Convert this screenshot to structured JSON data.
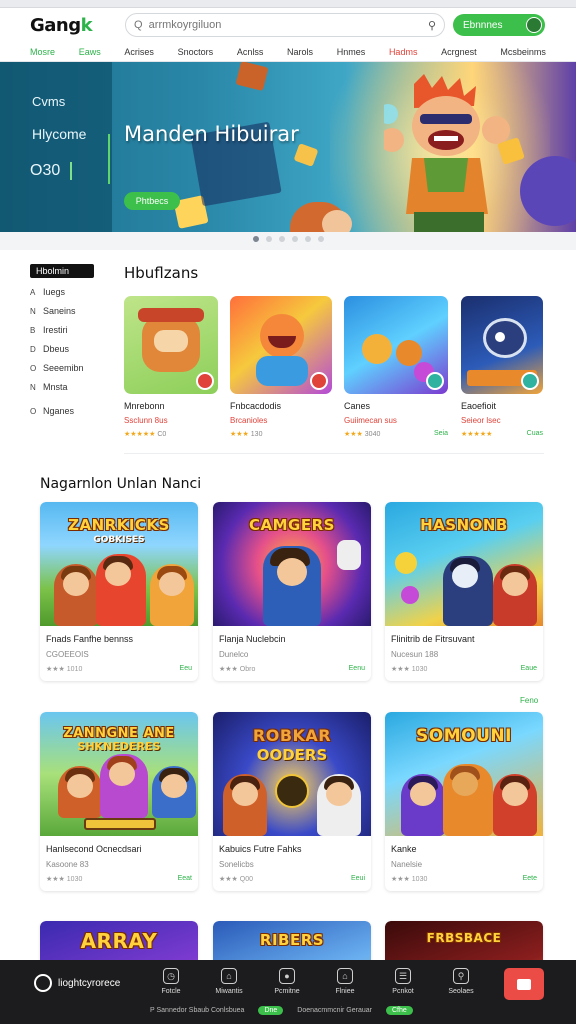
{
  "header": {
    "logo": "Gang",
    "logo_accent": "k",
    "search_placeholder": "Q  arrmkoyrgiluon",
    "cta_label": "Ebnnnes"
  },
  "nav": [
    "Mosre",
    "Eaws",
    "Acrises",
    "Snoctors",
    "Acnlss",
    "Narols",
    "Hnmes",
    "Hadms",
    "Acrgnest",
    "Mcsbeinms"
  ],
  "hero": {
    "side_line1": "Cvms",
    "side_line2": "Hlycome",
    "side_line3": "O30",
    "title": "Manden Hibuirar",
    "button": "Phtbecs"
  },
  "sidebar": {
    "header": "Hbolmin",
    "items": [
      {
        "icon": "user-icon",
        "glyph": "A",
        "label": "Iuegs"
      },
      {
        "icon": "bookmark-icon",
        "glyph": "N",
        "label": "Saneins"
      },
      {
        "icon": "calendar-icon",
        "glyph": "B",
        "label": "Irestiri"
      },
      {
        "icon": "square-icon",
        "glyph": "D",
        "label": "Dbeus"
      },
      {
        "icon": "circle-icon",
        "glyph": "O",
        "label": "Seeemibn"
      },
      {
        "icon": "grid-icon",
        "glyph": "N",
        "label": "Mnsta"
      },
      {
        "icon": "settings-icon",
        "glyph": "O",
        "label": "Nganes"
      }
    ]
  },
  "featured": {
    "title": "Hbuflzans",
    "items": [
      {
        "name": "Mnrebonn",
        "sub": "Ssclunn 8us",
        "rating": "★★★★★",
        "count": "C0",
        "action": ""
      },
      {
        "name": "Fnbcacdodis",
        "sub": "Brcanioles",
        "rating": "★★★",
        "count": "130",
        "action": ""
      },
      {
        "name": "Canes",
        "sub": "Guiimecan sus",
        "rating": "★★★",
        "count": "3040",
        "action": "Seia"
      },
      {
        "name": "Eaoefioit",
        "sub": "Seieor lsec",
        "rating": "★★★★★",
        "count": "",
        "action": "Cuas"
      }
    ]
  },
  "section": {
    "title": "Nagarnlon Unlan Nanci",
    "more": "Feno"
  },
  "cards": [
    {
      "art": "ZANRKICKS",
      "art_sub": "GOBKISES",
      "name": "Fnads Fanfhe bennss",
      "sub": "CGOEEOIS",
      "count": "1010",
      "action": "Eeu"
    },
    {
      "art": "CAMGERS",
      "art_sub": "",
      "name": "Flanja Nuclebcin",
      "sub": "Dunelco",
      "count": "Obro",
      "action": "Eenu"
    },
    {
      "art": "HASNONB",
      "art_sub": "",
      "name": "Flinitrib de Fitrsuvant",
      "sub": "Nucesun 188",
      "count": "1030",
      "action": "Eaue"
    },
    {
      "art": "ZANNGNE ANE",
      "art_sub": "SHKNEDERES",
      "name": "Hanlsecond Ocnecdsari",
      "sub": "Kasoone 83",
      "count": "1030",
      "action": "Eeat"
    },
    {
      "art": "ROBKAR",
      "art_sub": "OODERS",
      "name": "Kabuics Futre Fahks",
      "sub": "Sonelicbs",
      "count": "Q00",
      "action": "Eeui"
    },
    {
      "art": "SOMOUNI",
      "art_sub": "",
      "name": "Kanke",
      "sub": "Nanelsie",
      "count": "1030",
      "action": "Eete"
    },
    {
      "art": "ARRAY",
      "art_sub": "",
      "name": "",
      "sub": "",
      "count": "",
      "action": ""
    },
    {
      "art": "RIBERS",
      "art_sub": "",
      "name": "",
      "sub": "",
      "count": "",
      "action": ""
    },
    {
      "art": "FRBSBACE",
      "art_sub": "",
      "name": "",
      "sub": "",
      "count": "",
      "action": ""
    }
  ],
  "bottombar": {
    "logo_text": "lioghtcyrorece",
    "items": [
      {
        "icon": "clock-icon",
        "label": "Fotcle"
      },
      {
        "icon": "home-icon",
        "label": "Miwantis"
      },
      {
        "icon": "game-icon",
        "label": "Pcmitne"
      },
      {
        "icon": "house-icon",
        "label": "Flniee"
      },
      {
        "icon": "document-icon",
        "label": "Pcnkot"
      },
      {
        "icon": "search-icon",
        "label": "Seolaes"
      }
    ],
    "footer": [
      "P Sannedor Sbaub Conlsbuea",
      "Dne",
      "Doenacmmcnir Gerauar",
      "Cfhe"
    ]
  },
  "colors": {
    "accent": "#3cbf4b",
    "hot": "#e0433a",
    "dark": "#1c1c1e"
  }
}
